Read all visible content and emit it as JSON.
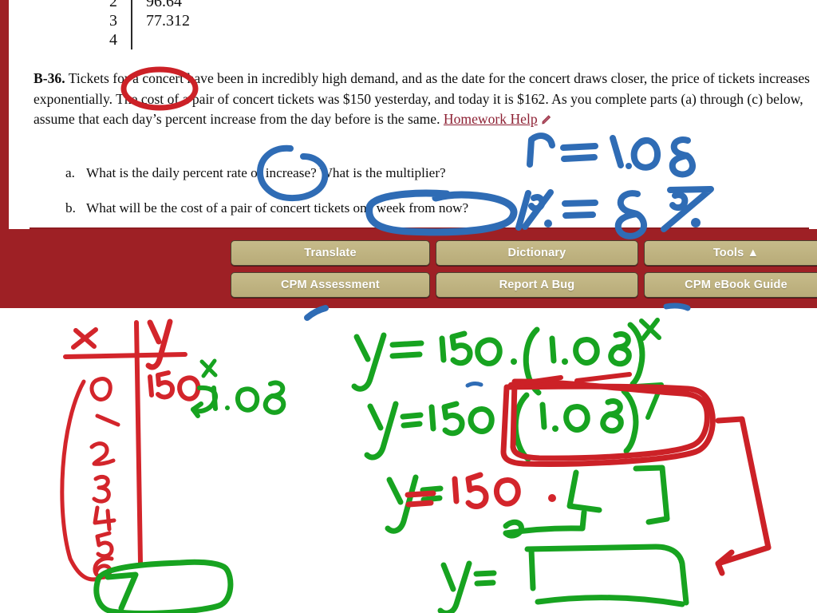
{
  "page": {
    "minitable": {
      "rows": [
        {
          "x": "2",
          "y": "96.64"
        },
        {
          "x": "3",
          "y": "77.312"
        },
        {
          "x": "4",
          "y": ""
        }
      ]
    },
    "problem": {
      "number": "B-36.",
      "text": "Tickets for a concert have been in incredibly high demand, and as the date for the concert draws closer, the price of tickets increases exponentially.  The cost of a pair of concert tickets was $150 yesterday, and today it is $162.  As you complete parts (a) through (c) below, assume that each day’s percent increase from the day before is the same. ",
      "homework_link": "Homework Help",
      "pencil_icon": "pencil-icon"
    },
    "parts": [
      {
        "letter": "a.",
        "text": "What is the daily percent rate of increase?  What is the multiplier?"
      },
      {
        "letter": "b.",
        "text": "What will be the cost of a pair of concert tickets one week from now?"
      }
    ]
  },
  "toolbar": {
    "background_color": "#9e2025",
    "button_color": "#bdb07c",
    "buttons": [
      {
        "label": "Translate",
        "name": "translate-button"
      },
      {
        "label": "Dictionary",
        "name": "dictionary-button"
      },
      {
        "label": "Tools ▲",
        "name": "tools-button"
      },
      {
        "label": "CPM Assessment",
        "name": "cpm-assessment-button"
      },
      {
        "label": "Report A Bug",
        "name": "report-a-bug-button"
      },
      {
        "label": "CPM eBook Guide",
        "name": "cpm-ebook-guide-button"
      }
    ]
  },
  "annotations": {
    "ink_colors": {
      "blue": "#2f6cb5",
      "red": "#d3252b",
      "red_dark": "#cc2127",
      "green": "#17a320"
    },
    "blue": [
      {
        "name": "annotation-n-equals",
        "text": "n = 1.08"
      },
      {
        "name": "annotation-percent-equals",
        "text": "% = 8 %"
      },
      {
        "name": "annotation-circle-rate-of-increase",
        "text": ""
      },
      {
        "name": "annotation-circle-one-week-from-now",
        "text": ""
      }
    ],
    "red": [
      {
        "name": "annotation-ellipse-exponentially",
        "text": ""
      },
      {
        "name": "annotation-table-header-x",
        "text": "x"
      },
      {
        "name": "annotation-table-header-y",
        "text": "y"
      },
      {
        "name": "annotation-table-x-values",
        "text": "0 1 2 3 4 5 6"
      },
      {
        "name": "annotation-table-y-150",
        "text": "150"
      },
      {
        "name": "annotation-150-dot",
        "text": "150 ."
      },
      {
        "name": "annotation-box-around-1-08-pow-7",
        "text": ""
      },
      {
        "name": "annotation-big-bracket-arrow",
        "text": ""
      }
    ],
    "green": [
      {
        "name": "annotation-superscript-x",
        "text": "x"
      },
      {
        "name": "annotation-multiplier-1-08",
        "text": "1.08"
      },
      {
        "name": "annotation-equation-y-150-1-08-x",
        "text": "y = 150 · (1.08)"
      },
      {
        "name": "annotation-equation-exponent-x",
        "text": "x"
      },
      {
        "name": "annotation-equation-y-150-1-08-7",
        "text": "y = 150 (1.08)"
      },
      {
        "name": "annotation-equation-exponent-7",
        "text": "7"
      },
      {
        "name": "annotation-equation-y-150-dot-blank",
        "text": "y ="
      },
      {
        "name": "annotation-blank-answer-box",
        "text": ""
      },
      {
        "name": "annotation-box-7",
        "text": "7"
      }
    ]
  }
}
